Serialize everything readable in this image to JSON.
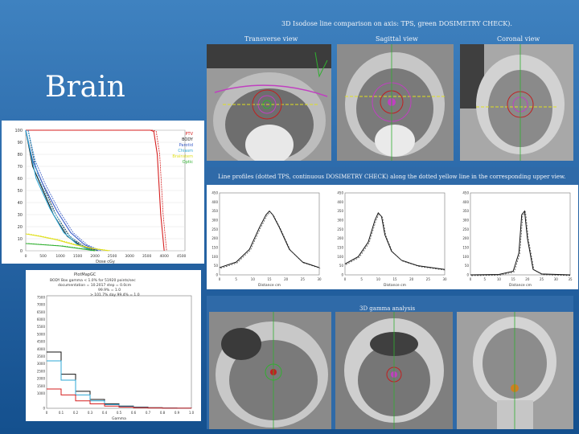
{
  "header": {
    "top_title": "3D Isodose line comparison on axis: TPS, green DOSIMETRY CHECK).",
    "view_transverse": "Transverse view",
    "view_sagittal": "Sagittal view",
    "view_coronal": "Coronal view",
    "line_profiles_caption": "Line profiles (dotted TPS, continuous DOSIMETRY CHECK) along the dotted yellow line in the corresponding upper view.",
    "gamma_caption": "3D gamma analysis"
  },
  "slide": {
    "title": "Brain"
  },
  "dvh_legend": [
    "PTV",
    "BODY",
    "Parotid",
    "Chiasm",
    "Brainstem",
    "Optic"
  ],
  "gamma_panel_text": {
    "title": "PlotMapGC",
    "body_line": "BODY  Box  gamma < 1.0% for 51920  points/sec",
    "note1": "documentation = 10.2017  step = 0.0cm",
    "note2": "99.9%  =  1.0",
    "note3": "> 101.7%  day  99.4%  =  1.0"
  },
  "chart_data": [
    {
      "type": "line",
      "title": "",
      "xlabel": "Dose cGy",
      "ylabel": "",
      "x_ticks": [
        "0",
        "500",
        "1000",
        "1500",
        "2000",
        "2500",
        "3000",
        "3500",
        "4000",
        "4500"
      ],
      "y_ticks": [
        "0",
        "10",
        "20",
        "30",
        "40",
        "50",
        "60",
        "70",
        "80",
        "90",
        "100"
      ],
      "ylim": [
        0,
        100
      ],
      "xlim": [
        0,
        4600
      ],
      "series": [
        {
          "color": "#d61f1f",
          "x": [
            0,
            3600,
            3700,
            3800,
            3900,
            4000
          ],
          "y": [
            100,
            100,
            99,
            80,
            30,
            0
          ]
        },
        {
          "color": "#222222",
          "x": [
            0,
            200,
            500,
            800,
            1200,
            1600,
            2000
          ],
          "y": [
            100,
            70,
            50,
            30,
            12,
            4,
            0
          ]
        },
        {
          "color": "#3a5cc8",
          "x": [
            0,
            200,
            500,
            900,
            1300,
            1700,
            2100
          ],
          "y": [
            100,
            75,
            55,
            33,
            15,
            5,
            0
          ]
        },
        {
          "color": "#2ea7d6",
          "x": [
            0,
            300,
            700,
            1100,
            1500,
            1900
          ],
          "y": [
            100,
            60,
            35,
            15,
            5,
            0
          ]
        },
        {
          "color": "#e0e020",
          "x": [
            0,
            400,
            900,
            1400,
            1900,
            2400
          ],
          "y": [
            14,
            12,
            9,
            5,
            2,
            0
          ]
        },
        {
          "color": "#30b030",
          "x": [
            0,
            500,
            1000,
            1500,
            2000
          ],
          "y": [
            6,
            5,
            4,
            2,
            0
          ]
        }
      ]
    },
    {
      "type": "line",
      "title": "",
      "xlabel": "Distance cm",
      "ylabel": "",
      "x_ticks": [
        "0",
        "5",
        "10",
        "15",
        "20",
        "25",
        "30"
      ],
      "y_ticks": [
        "0",
        "50",
        "100",
        "150",
        "200",
        "250",
        "300",
        "350",
        "400",
        "450"
      ],
      "ylim": [
        0,
        450
      ],
      "series": [
        {
          "x": [
            0,
            5,
            9,
            12,
            14,
            15,
            16,
            18,
            21,
            25,
            30
          ],
          "y": [
            40,
            70,
            140,
            260,
            330,
            350,
            330,
            260,
            140,
            70,
            40
          ]
        }
      ]
    },
    {
      "type": "line",
      "title": "",
      "xlabel": "Distance cm",
      "ylabel": "",
      "x_ticks": [
        "0",
        "5",
        "10",
        "15",
        "20",
        "25",
        "30"
      ],
      "y_ticks": [
        "0",
        "50",
        "100",
        "150",
        "200",
        "250",
        "300",
        "350",
        "400",
        "450"
      ],
      "ylim": [
        0,
        450
      ],
      "series": [
        {
          "x": [
            0,
            4,
            7,
            9,
            10,
            11,
            12,
            14,
            17,
            22,
            30
          ],
          "y": [
            60,
            100,
            180,
            300,
            340,
            320,
            220,
            130,
            80,
            50,
            30
          ]
        }
      ]
    },
    {
      "type": "line",
      "title": "",
      "xlabel": "Distance cm",
      "ylabel": "",
      "x_ticks": [
        "0",
        "5",
        "10",
        "15",
        "20",
        "25",
        "30",
        "35"
      ],
      "y_ticks": [
        "0",
        "50",
        "100",
        "150",
        "200",
        "250",
        "300",
        "350",
        "400",
        "450"
      ],
      "ylim": [
        0,
        450
      ],
      "series": [
        {
          "x": [
            0,
            10,
            15,
            17,
            18,
            19,
            20,
            22,
            25,
            35
          ],
          "y": [
            0,
            2,
            20,
            120,
            330,
            350,
            200,
            30,
            5,
            0
          ]
        }
      ]
    },
    {
      "type": "bar",
      "title": "",
      "xlabel": "Gamma",
      "ylabel": "",
      "x_ticks": [
        "0",
        "0.1",
        "0.2",
        "0.3",
        "0.4",
        "0.5",
        "0.6",
        "0.7",
        "0.8",
        "0.9",
        "1.0"
      ],
      "y_ticks": [
        "0",
        "1000",
        "1500",
        "2000",
        "2500",
        "3000",
        "3500",
        "4000",
        "4500",
        "5000",
        "5500",
        "6000",
        "6500",
        "7000",
        "7500"
      ],
      "ylim": [
        0,
        7600
      ],
      "categories": [
        "0-0.1",
        "0.1-0.2",
        "0.2-0.3",
        "0.3-0.4",
        "0.4-0.5",
        "0.5-0.6",
        "0.6-0.7",
        "0.7-0.8",
        "0.8-0.9",
        "0.9-1.0"
      ],
      "series": [
        {
          "color": "#111111",
          "values": [
            3800,
            2300,
            1150,
            600,
            300,
            150,
            80,
            40,
            20,
            10
          ]
        },
        {
          "color": "#2ea7d6",
          "values": [
            3200,
            1900,
            900,
            500,
            250,
            120,
            60,
            30,
            15,
            8
          ]
        },
        {
          "color": "#d61f1f",
          "values": [
            1300,
            900,
            500,
            300,
            150,
            80,
            40,
            20,
            10,
            5
          ]
        }
      ]
    }
  ]
}
